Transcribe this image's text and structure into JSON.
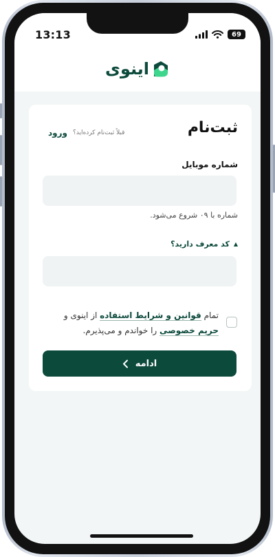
{
  "status_bar": {
    "time": "13:13",
    "battery": "69"
  },
  "app": {
    "logo_text": "اینوی"
  },
  "signup": {
    "title": "ثبت‌نام",
    "already_registered": "قبلاً ثبت‌نام کرده‌اید؟",
    "login_label": "ورود",
    "mobile_label": "شماره موبایل",
    "mobile_value": "",
    "mobile_placeholder": "",
    "mobile_hint": "شماره با ۰۹ شروع می‌شود.",
    "referral_label": "کد معرف دارید؟",
    "referral_value": "",
    "referral_placeholder": "",
    "terms": {
      "prefix": "تمام",
      "terms_link": "قوانین و شرایط استفاده",
      "middle": "از اینوی و",
      "privacy_link": "حریم خصوصی",
      "suffix": "را خواندم و می‌پذیرم.",
      "checked": false
    },
    "continue_label": "ادامه"
  },
  "icons": {
    "signal": "cellular-signal-icon",
    "wifi": "wifi-icon",
    "battery": "battery-icon",
    "logo": "inwi-logo-icon",
    "referral_toggle": "triangle-up-icon",
    "continue": "chevron-left-icon"
  },
  "colors": {
    "brand": "#0c4a3c",
    "brand_accent": "#3dd68c",
    "page_background": "#f2f6f6",
    "input_background": "#eff3f3"
  }
}
